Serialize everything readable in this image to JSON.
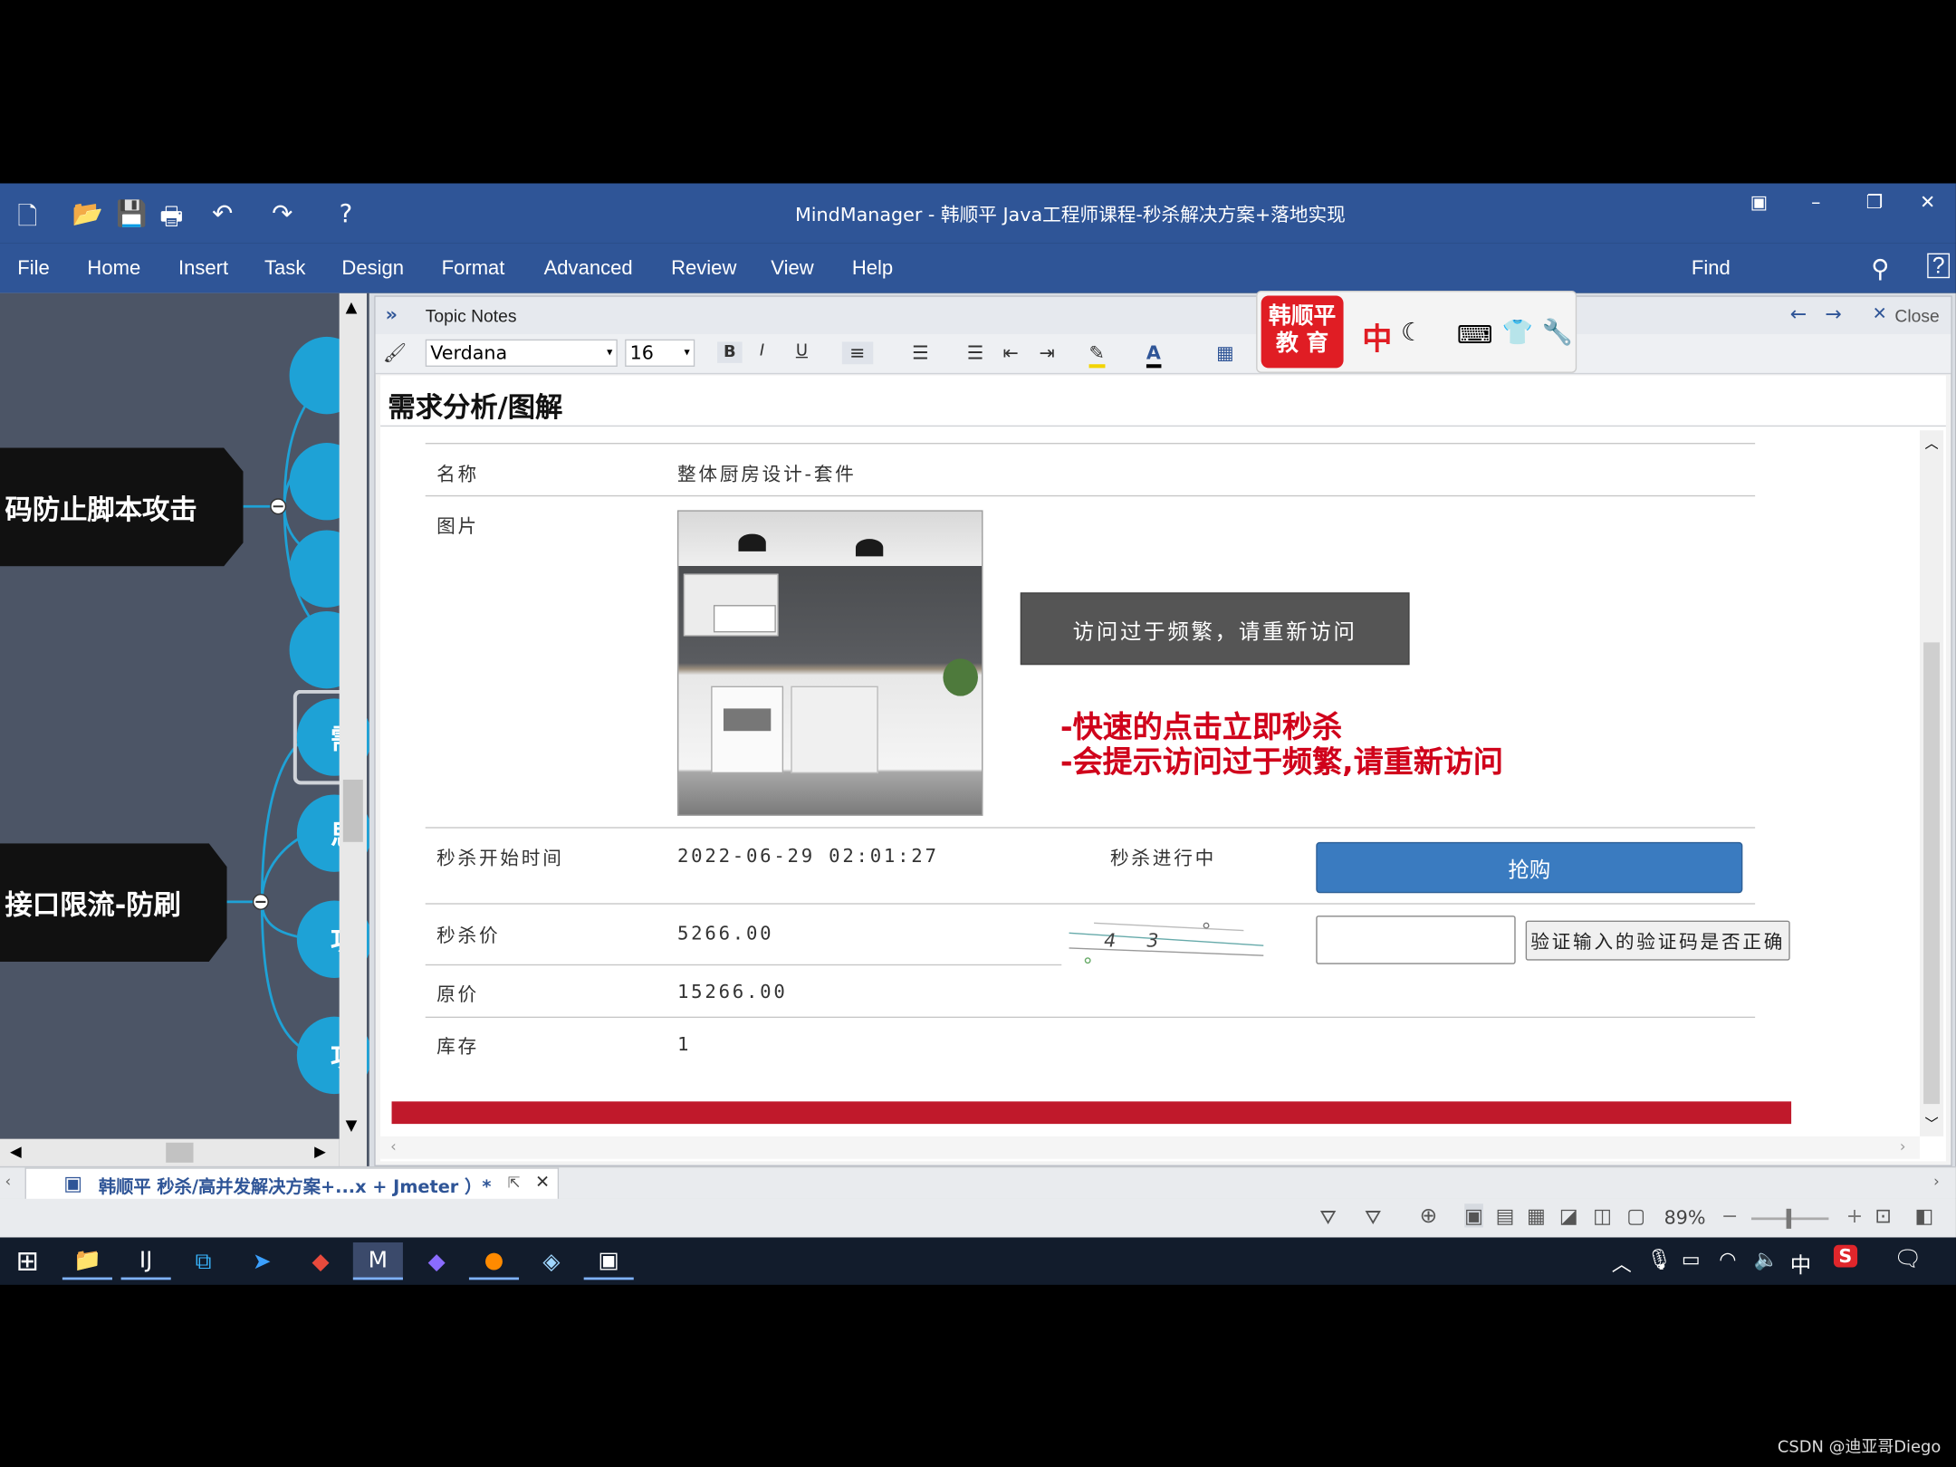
{
  "window": {
    "title": "MindManager - 韩顺平 Java工程师课程-秒杀解决方案+落地实现",
    "controls": [
      "▣",
      "–",
      "❐",
      "✕"
    ]
  },
  "menu": [
    "File",
    "Home",
    "Insert",
    "Task",
    "Design",
    "Format",
    "Advanced",
    "Review",
    "View",
    "Help"
  ],
  "menu_find": "Find",
  "map": {
    "node_top": "码防止脚本攻击",
    "node_bottom": "接口限流-防刷",
    "circle_labels": [
      "需",
      "思",
      "功",
      "功"
    ]
  },
  "notes": {
    "panel_title": "Topic Notes",
    "close_label": "Close",
    "font_name": "Verdana",
    "font_size": "16",
    "doc_title": "需求分析/图解"
  },
  "brand_badge": "韩顺平\n教 育",
  "ime_text": "中",
  "product": {
    "name_label": "名称",
    "name_value": "整体厨房设计-套件",
    "image_label": "图片",
    "start_label": "秒杀开始时间",
    "start_value": "2022-06-29 02:01:27",
    "status": "秒杀进行中",
    "buy_button": "抢购",
    "price_label": "秒杀价",
    "price_value": "5266.00",
    "captcha_text": "4  3",
    "verify_button": "验证输入的验证码是否正确",
    "original_label": "原价",
    "original_value": "15266.00",
    "stock_label": "库存",
    "stock_value": "1"
  },
  "alert": "访问过于频繁，请重新访问",
  "annotations": [
    "-快速的点击立即秒杀",
    "-会提示访问过于频繁,请重新访问"
  ],
  "tab": {
    "label": "韩顺平 秒杀/高并发解决方案+...x + Jmeter ）*"
  },
  "status": {
    "zoom": "89%"
  },
  "taskbar": {
    "ime": "中"
  },
  "watermark": "CSDN @迪亚哥Diego",
  "colors": {
    "titlebar": "#2f5597",
    "buy_button": "#3a7bc0",
    "alert_bg": "#555555",
    "annotation": "#d0021b",
    "footer_bar": "#c0192b"
  }
}
